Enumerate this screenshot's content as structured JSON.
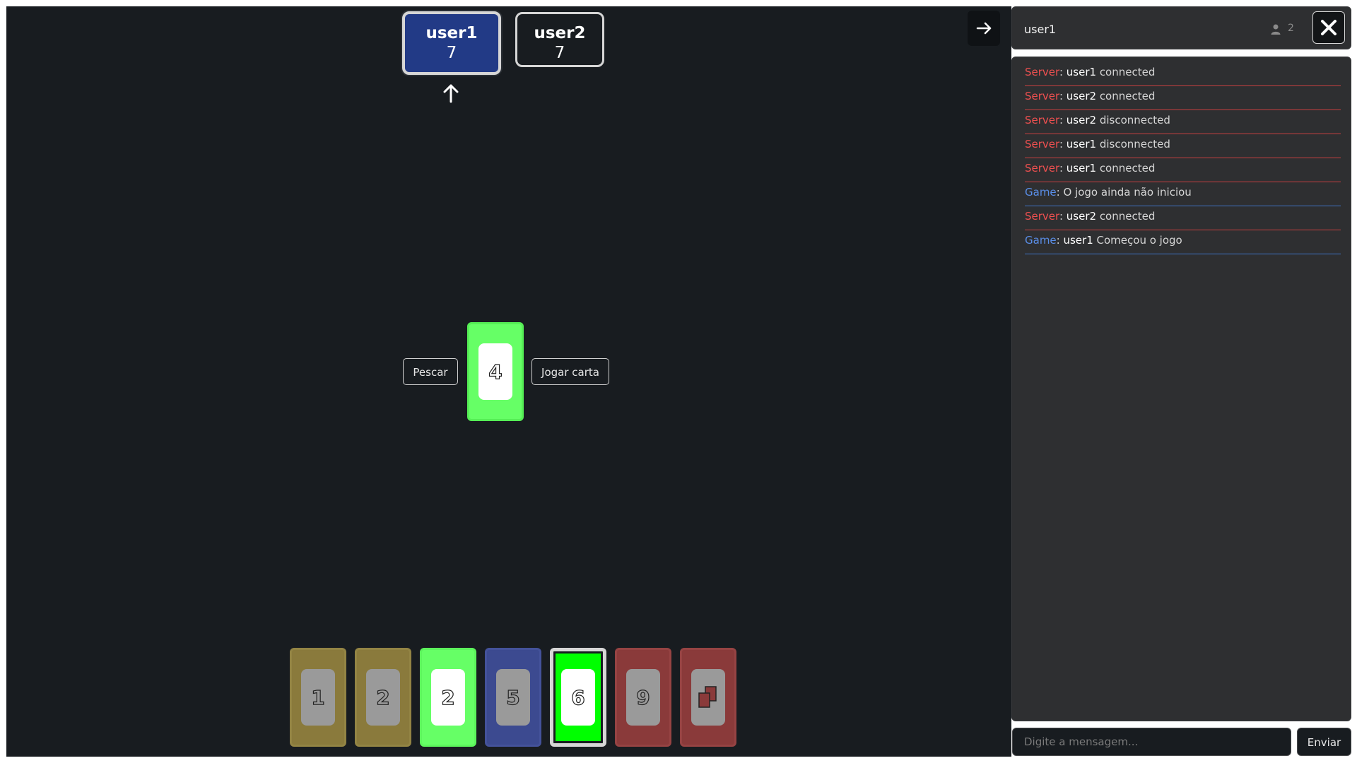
{
  "players": [
    {
      "name": "user1",
      "count": "7"
    },
    {
      "name": "user2",
      "count": "7"
    }
  ],
  "current_turn": "user1",
  "pile": {
    "value": "4",
    "color": "#66ff66"
  },
  "actions": {
    "draw_label": "Pescar",
    "play_label": "Jogar carta"
  },
  "hand": [
    {
      "value": "1",
      "color": "yellow"
    },
    {
      "value": "2",
      "color": "yellow"
    },
    {
      "value": "2",
      "color": "green"
    },
    {
      "value": "5",
      "color": "blue"
    },
    {
      "value": "6",
      "color": "green",
      "selected": true
    },
    {
      "value": "9",
      "color": "red"
    },
    {
      "value": "",
      "color": "red",
      "icon": "draw-two-icon"
    }
  ],
  "sidebar": {
    "user": "user1",
    "online_count": "2",
    "icons": {
      "collapse": "arrow-right-icon",
      "close": "close-icon",
      "users": "user-icon"
    }
  },
  "chat": {
    "messages": [
      {
        "source": "Server",
        "user": "user1",
        "text": "connected"
      },
      {
        "source": "Server",
        "user": "user2",
        "text": "connected"
      },
      {
        "source": "Server",
        "user": "user2",
        "text": "disconnected"
      },
      {
        "source": "Server",
        "user": "user1",
        "text": "disconnected"
      },
      {
        "source": "Server",
        "user": "user1",
        "text": "connected"
      },
      {
        "source": "Game",
        "user": "",
        "text": "O jogo ainda não iniciou"
      },
      {
        "source": "Server",
        "user": "user2",
        "text": "connected"
      },
      {
        "source": "Game",
        "user": "user1",
        "text": "Começou o jogo"
      }
    ],
    "input_placeholder": "Digite a mensagem...",
    "send_label": "Enviar"
  },
  "colors": {
    "background": "#181c20",
    "yellow": "#8a7a3c",
    "green": "#66ff66",
    "blue": "#3c4a90",
    "red": "#8a3a3a",
    "server": "#f05050",
    "game": "#5a8ee8"
  }
}
